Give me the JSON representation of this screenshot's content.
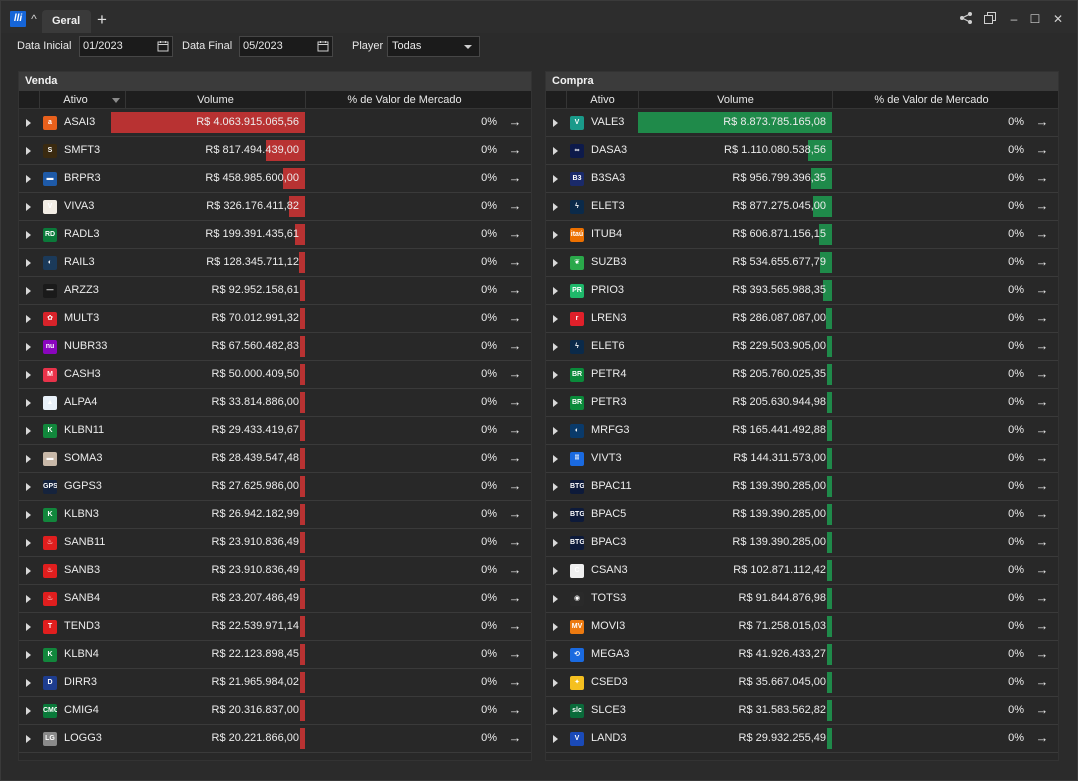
{
  "app": {
    "logo_text": "lli",
    "tab_label": "Geral",
    "add_tab": "+",
    "collapse": "^",
    "controls": {
      "share": "share-icon",
      "popout": "popout-icon",
      "minimize": "–",
      "maximize": "☐",
      "close": "✕"
    }
  },
  "filters": {
    "data_inicial_label": "Data Inicial",
    "data_inicial_value": "01/2023",
    "data_final_label": "Data Final",
    "data_final_value": "05/2023",
    "player_label": "Player",
    "player_value": "Todas"
  },
  "columns": {
    "ativo": "Ativo",
    "volume": "Volume",
    "pct": "% de Valor de Mercado"
  },
  "colors": {
    "venda_bar": "#b83232",
    "compra_bar": "#1f8a4a"
  },
  "venda": {
    "title": "Venda",
    "rows": [
      {
        "ticker": "ASAI3",
        "volume": "R$ 4.063.915.065,56",
        "pct": "0%",
        "bar": 1.0,
        "logo_color": "#e8601c",
        "logo_text": "a"
      },
      {
        "ticker": "SMFT3",
        "volume": "R$ 817.494.439,00",
        "pct": "0%",
        "bar": 0.2,
        "logo_color": "#3a2a10",
        "logo_text": "S"
      },
      {
        "ticker": "BRPR3",
        "volume": "R$ 458.985.600,00",
        "pct": "0%",
        "bar": 0.113,
        "logo_color": "#1e5aa8",
        "logo_text": "▬"
      },
      {
        "ticker": "VIVA3",
        "volume": "R$ 326.176.411,82",
        "pct": "0%",
        "bar": 0.08,
        "logo_color": "#f2ede4",
        "logo_text": "V"
      },
      {
        "ticker": "RADL3",
        "volume": "R$ 199.391.435,61",
        "pct": "0%",
        "bar": 0.049,
        "logo_color": "#0b7a3a",
        "logo_text": "RD"
      },
      {
        "ticker": "RAIL3",
        "volume": "R$ 128.345.711,12",
        "pct": "0%",
        "bar": 0.032,
        "logo_color": "#1b3a5a",
        "logo_text": "◐"
      },
      {
        "ticker": "ARZZ3",
        "volume": "R$ 92.952.158,61",
        "pct": "0%",
        "bar": 0.023,
        "logo_color": "#1a1a1a",
        "logo_text": "—"
      },
      {
        "ticker": "MULT3",
        "volume": "R$ 70.012.991,32",
        "pct": "0%",
        "bar": 0.017,
        "logo_color": "#d8232a",
        "logo_text": "✿"
      },
      {
        "ticker": "NUBR33",
        "volume": "R$ 67.560.482,83",
        "pct": "0%",
        "bar": 0.017,
        "logo_color": "#8a05be",
        "logo_text": "nu"
      },
      {
        "ticker": "CASH3",
        "volume": "R$ 50.000.409,50",
        "pct": "0%",
        "bar": 0.012,
        "logo_color": "#e8334a",
        "logo_text": "M"
      },
      {
        "ticker": "ALPA4",
        "volume": "R$ 33.814.886,00",
        "pct": "0%",
        "bar": 0.008,
        "logo_color": "#e8f0f8",
        "logo_text": "▲"
      },
      {
        "ticker": "KLBN11",
        "volume": "R$ 29.433.419,67",
        "pct": "0%",
        "bar": 0.007,
        "logo_color": "#12873c",
        "logo_text": "K"
      },
      {
        "ticker": "SOMA3",
        "volume": "R$ 28.439.547,48",
        "pct": "0%",
        "bar": 0.007,
        "logo_color": "#c8b8a8",
        "logo_text": "▬"
      },
      {
        "ticker": "GGPS3",
        "volume": "R$ 27.625.986,00",
        "pct": "0%",
        "bar": 0.007,
        "logo_color": "#15233d",
        "logo_text": "GPS"
      },
      {
        "ticker": "KLBN3",
        "volume": "R$ 26.942.182,99",
        "pct": "0%",
        "bar": 0.007,
        "logo_color": "#12873c",
        "logo_text": "K"
      },
      {
        "ticker": "SANB11",
        "volume": "R$ 23.910.836,49",
        "pct": "0%",
        "bar": 0.006,
        "logo_color": "#e01e1e",
        "logo_text": "♨"
      },
      {
        "ticker": "SANB3",
        "volume": "R$ 23.910.836,49",
        "pct": "0%",
        "bar": 0.006,
        "logo_color": "#e01e1e",
        "logo_text": "♨"
      },
      {
        "ticker": "SANB4",
        "volume": "R$ 23.207.486,49",
        "pct": "0%",
        "bar": 0.006,
        "logo_color": "#e01e1e",
        "logo_text": "♨"
      },
      {
        "ticker": "TEND3",
        "volume": "R$ 22.539.971,14",
        "pct": "0%",
        "bar": 0.006,
        "logo_color": "#e01e1e",
        "logo_text": "T"
      },
      {
        "ticker": "KLBN4",
        "volume": "R$ 22.123.898,45",
        "pct": "0%",
        "bar": 0.005,
        "logo_color": "#12873c",
        "logo_text": "K"
      },
      {
        "ticker": "DIRR3",
        "volume": "R$ 21.965.984,02",
        "pct": "0%",
        "bar": 0.005,
        "logo_color": "#1e3d8f",
        "logo_text": "D"
      },
      {
        "ticker": "CMIG4",
        "volume": "R$ 20.316.837,00",
        "pct": "0%",
        "bar": 0.005,
        "logo_color": "#0a7a3a",
        "logo_text": "CMG"
      },
      {
        "ticker": "LOGG3",
        "volume": "R$ 20.221.866,00",
        "pct": "0%",
        "bar": 0.005,
        "logo_color": "#8a8a8a",
        "logo_text": "LG"
      }
    ]
  },
  "compra": {
    "title": "Compra",
    "rows": [
      {
        "ticker": "VALE3",
        "volume": "R$ 8.873.785.165,08",
        "pct": "0%",
        "bar": 1.0,
        "logo_color": "#1a9a8a",
        "logo_text": "V"
      },
      {
        "ticker": "DASA3",
        "volume": "R$ 1.110.080.538,56",
        "pct": "0%",
        "bar": 0.125,
        "logo_color": "#0d1a4a",
        "logo_text": "∞"
      },
      {
        "ticker": "B3SA3",
        "volume": "R$ 956.799.396,35",
        "pct": "0%",
        "bar": 0.108,
        "logo_color": "#1a2a6a",
        "logo_text": "B3"
      },
      {
        "ticker": "ELET3",
        "volume": "R$ 877.275.045,00",
        "pct": "0%",
        "bar": 0.099,
        "logo_color": "#0a2a4a",
        "logo_text": "ϟ"
      },
      {
        "ticker": "ITUB4",
        "volume": "R$ 606.871.156,15",
        "pct": "0%",
        "bar": 0.068,
        "logo_color": "#ec7000",
        "logo_text": "itaú"
      },
      {
        "ticker": "SUZB3",
        "volume": "R$ 534.655.677,79",
        "pct": "0%",
        "bar": 0.06,
        "logo_color": "#2aa84a",
        "logo_text": "❦"
      },
      {
        "ticker": "PRIO3",
        "volume": "R$ 393.565.988,35",
        "pct": "0%",
        "bar": 0.044,
        "logo_color": "#1eb86a",
        "logo_text": "PR"
      },
      {
        "ticker": "LREN3",
        "volume": "R$ 286.087.087,00",
        "pct": "0%",
        "bar": 0.032,
        "logo_color": "#e0202a",
        "logo_text": "r"
      },
      {
        "ticker": "ELET6",
        "volume": "R$ 229.503.905,00",
        "pct": "0%",
        "bar": 0.026,
        "logo_color": "#0a2a4a",
        "logo_text": "ϟ"
      },
      {
        "ticker": "PETR4",
        "volume": "R$ 205.760.025,35",
        "pct": "0%",
        "bar": 0.023,
        "logo_color": "#0a8a3a",
        "logo_text": "BR"
      },
      {
        "ticker": "PETR3",
        "volume": "R$ 205.630.944,98",
        "pct": "0%",
        "bar": 0.023,
        "logo_color": "#0a8a3a",
        "logo_text": "BR"
      },
      {
        "ticker": "MRFG3",
        "volume": "R$ 165.441.492,88",
        "pct": "0%",
        "bar": 0.019,
        "logo_color": "#0a3a6a",
        "logo_text": "◐"
      },
      {
        "ticker": "VIVT3",
        "volume": "R$ 144.311.573,00",
        "pct": "0%",
        "bar": 0.016,
        "logo_color": "#1a6ae0",
        "logo_text": "⠿"
      },
      {
        "ticker": "BPAC11",
        "volume": "R$ 139.390.285,00",
        "pct": "0%",
        "bar": 0.016,
        "logo_color": "#0d1a3a",
        "logo_text": "BTG"
      },
      {
        "ticker": "BPAC5",
        "volume": "R$ 139.390.285,00",
        "pct": "0%",
        "bar": 0.016,
        "logo_color": "#0d1a3a",
        "logo_text": "BTG"
      },
      {
        "ticker": "BPAC3",
        "volume": "R$ 139.390.285,00",
        "pct": "0%",
        "bar": 0.016,
        "logo_color": "#0d1a3a",
        "logo_text": "BTG"
      },
      {
        "ticker": "CSAN3",
        "volume": "R$ 102.871.112,42",
        "pct": "0%",
        "bar": 0.012,
        "logo_color": "#f0f0f0",
        "logo_text": "C"
      },
      {
        "ticker": "TOTS3",
        "volume": "R$ 91.844.876,98",
        "pct": "0%",
        "bar": 0.01,
        "logo_color": "#2a2a2a",
        "logo_text": "◉"
      },
      {
        "ticker": "MOVI3",
        "volume": "R$ 71.258.015,03",
        "pct": "0%",
        "bar": 0.008,
        "logo_color": "#ec7a10",
        "logo_text": "MV"
      },
      {
        "ticker": "MEGA3",
        "volume": "R$ 41.926.433,27",
        "pct": "0%",
        "bar": 0.005,
        "logo_color": "#1a6ae0",
        "logo_text": "⟲"
      },
      {
        "ticker": "CSED3",
        "volume": "R$ 35.667.045,00",
        "pct": "0%",
        "bar": 0.004,
        "logo_color": "#f5c020",
        "logo_text": "✦"
      },
      {
        "ticker": "SLCE3",
        "volume": "R$ 31.583.562,82",
        "pct": "0%",
        "bar": 0.004,
        "logo_color": "#0a6a3a",
        "logo_text": "slc"
      },
      {
        "ticker": "LAND3",
        "volume": "R$ 29.932.255,49",
        "pct": "0%",
        "bar": 0.003,
        "logo_color": "#1a4ab8",
        "logo_text": "V"
      }
    ]
  }
}
